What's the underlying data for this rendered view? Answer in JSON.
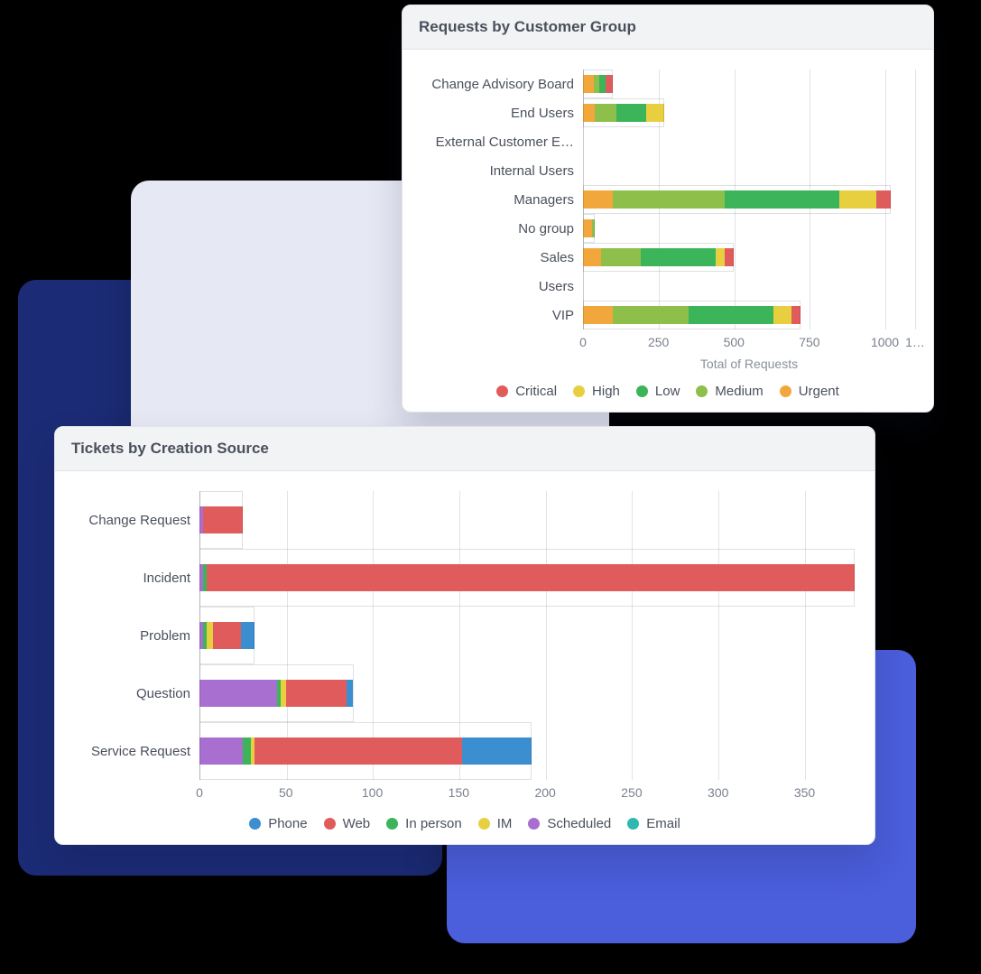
{
  "colors": {
    "critical": "#e05c5c",
    "high": "#e8cf3f",
    "low": "#3cb55a",
    "medium": "#8dbf4a",
    "urgent": "#f2a73d",
    "phone": "#3b8fd1",
    "web": "#e05c5c",
    "in_person": "#3cb55a",
    "im": "#e8cf3f",
    "scheduled": "#a86fd1",
    "email": "#2fb8b0"
  },
  "chart_data": [
    {
      "id": "customer_group",
      "type": "bar",
      "orientation": "horizontal",
      "stacked": true,
      "title": "Requests by Customer Group",
      "xlabel": "Total of Requests",
      "ylabel": "",
      "xlim": [
        0,
        1100
      ],
      "xticks": [
        0,
        250,
        500,
        750,
        1000,
        1100
      ],
      "xtick_labels": [
        "0",
        "250",
        "500",
        "750",
        "1000",
        "1…"
      ],
      "categories": [
        "Change Advisory Board",
        "End Users",
        "External Customer E…",
        "Internal Users",
        "Managers",
        "No group",
        "Sales",
        "Users",
        "VIP"
      ],
      "series_order": [
        "urgent",
        "medium",
        "low",
        "high",
        "critical"
      ],
      "series": [
        {
          "id": "critical",
          "name": "Critical",
          "values": [
            25,
            0,
            0,
            0,
            50,
            0,
            30,
            0,
            30
          ]
        },
        {
          "id": "high",
          "name": "High",
          "values": [
            0,
            60,
            0,
            0,
            120,
            0,
            30,
            0,
            60
          ]
        },
        {
          "id": "low",
          "name": "Low",
          "values": [
            20,
            100,
            0,
            0,
            380,
            0,
            250,
            0,
            280
          ]
        },
        {
          "id": "medium",
          "name": "Medium",
          "values": [
            20,
            70,
            0,
            0,
            370,
            10,
            130,
            0,
            250
          ]
        },
        {
          "id": "urgent",
          "name": "Urgent",
          "values": [
            35,
            40,
            0,
            0,
            100,
            30,
            60,
            0,
            100
          ]
        }
      ],
      "legend": [
        {
          "id": "critical",
          "label": "Critical"
        },
        {
          "id": "high",
          "label": "High"
        },
        {
          "id": "low",
          "label": "Low"
        },
        {
          "id": "medium",
          "label": "Medium"
        },
        {
          "id": "urgent",
          "label": "Urgent"
        }
      ]
    },
    {
      "id": "creation_source",
      "type": "bar",
      "orientation": "horizontal",
      "stacked": true,
      "title": "Tickets by Creation Source",
      "xlabel": "",
      "ylabel": "",
      "xlim": [
        0,
        380
      ],
      "xticks": [
        0,
        50,
        100,
        150,
        200,
        250,
        300,
        350
      ],
      "xtick_labels": [
        "0",
        "50",
        "100",
        "150",
        "200",
        "250",
        "300",
        "350"
      ],
      "categories": [
        "Change Request",
        "Incident",
        "Problem",
        "Question",
        "Service Request"
      ],
      "series_order": [
        "scheduled",
        "in_person",
        "im",
        "web",
        "phone"
      ],
      "series": [
        {
          "id": "phone",
          "name": "Phone",
          "values": [
            0,
            0,
            8,
            4,
            40
          ]
        },
        {
          "id": "web",
          "name": "Web",
          "values": [
            23,
            375,
            16,
            35,
            120
          ]
        },
        {
          "id": "in_person",
          "name": "In person",
          "values": [
            0,
            2,
            2,
            2,
            5
          ]
        },
        {
          "id": "im",
          "name": "IM",
          "values": [
            0,
            0,
            4,
            3,
            2
          ]
        },
        {
          "id": "scheduled",
          "name": "Scheduled",
          "values": [
            2,
            2,
            2,
            45,
            25
          ]
        },
        {
          "id": "email",
          "name": "Email",
          "values": [
            0,
            0,
            0,
            0,
            0
          ]
        }
      ],
      "legend": [
        {
          "id": "phone",
          "label": "Phone"
        },
        {
          "id": "web",
          "label": "Web"
        },
        {
          "id": "in_person",
          "label": "In person"
        },
        {
          "id": "im",
          "label": "IM"
        },
        {
          "id": "scheduled",
          "label": "Scheduled"
        },
        {
          "id": "email",
          "label": "Email"
        }
      ]
    }
  ]
}
